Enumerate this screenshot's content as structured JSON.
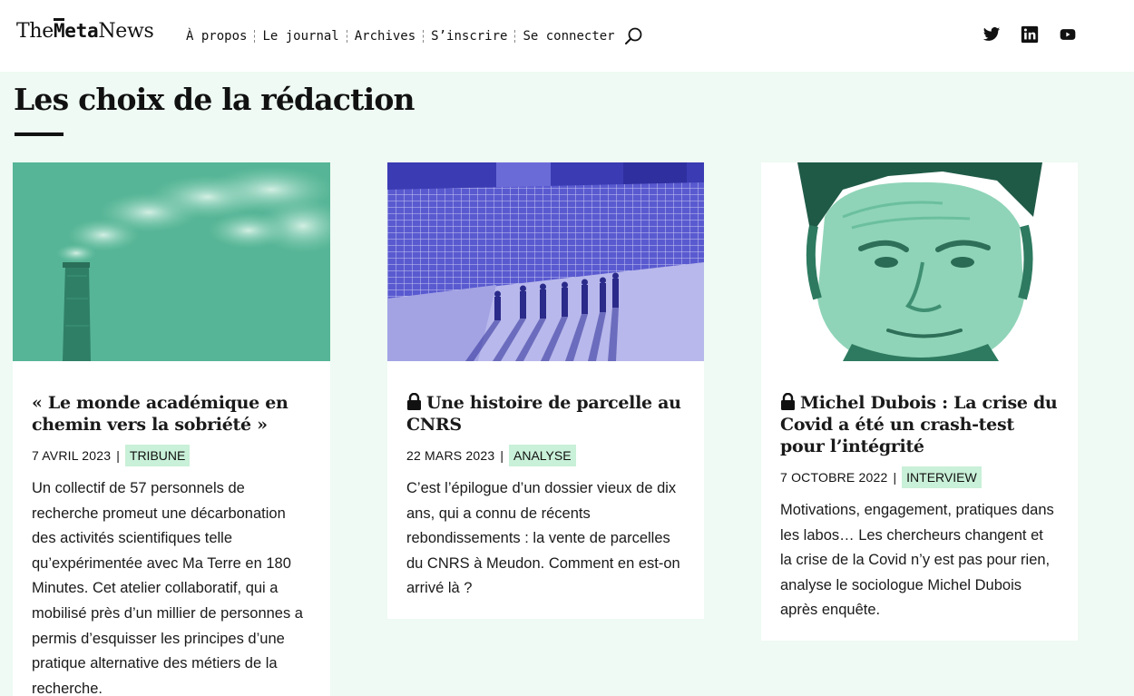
{
  "header": {
    "logo": {
      "part1": "The",
      "part2": "Meta",
      "part3": "News"
    },
    "nav": [
      {
        "label": "À propos"
      },
      {
        "label": "Le journal"
      },
      {
        "label": "Archives"
      },
      {
        "label": "S’inscrire"
      },
      {
        "label": "Se connecter"
      }
    ],
    "icons": {
      "search": "search-icon",
      "twitter": "twitter-icon",
      "linkedin": "linkedin-icon",
      "youtube": "youtube-icon"
    }
  },
  "section": {
    "title": "Les choix de la rédaction"
  },
  "colors": {
    "accent_green": "#4fb392",
    "accent_blue": "#4d4dc8",
    "badge_bg": "#c9f0d8",
    "page_bg": "#eefaf3"
  },
  "cards": [
    {
      "locked": false,
      "title": "« Le monde académique en chemin vers la sobriété »",
      "date": "7 avril 2023",
      "category": "Tribune",
      "excerpt": "Un collectif de 57 personnels de recherche promeut une décarbonation des activités scientifiques telle qu’expérimentée avec Ma Terre en 180 Minutes. Cet atelier collaboratif, qui a mobilisé près d’un millier de personnes a permis d’esquisser les principes d’une pratique alternative des métiers de la recherche."
    },
    {
      "locked": true,
      "title": "Une histoire de parcelle au CNRS",
      "date": "22 mars 2023",
      "category": "Analyse",
      "excerpt": "C’est l’épilogue d’un dossier vieux de dix ans, qui a connu de récents rebondissements : la vente de parcelles du CNRS à Meudon. Comment en est-on arrivé là ?"
    },
    {
      "locked": true,
      "title": "Michel Dubois : La crise du Covid a été un crash-test pour l’intégrité",
      "date": "7 octobre 2022",
      "category": "Interview",
      "excerpt": "Motivations, engagement, pratiques dans les labos… Les chercheurs changent et la crise de la Covid n’y est pas pour rien, analyse le sociologue Michel Dubois après enquête."
    }
  ]
}
